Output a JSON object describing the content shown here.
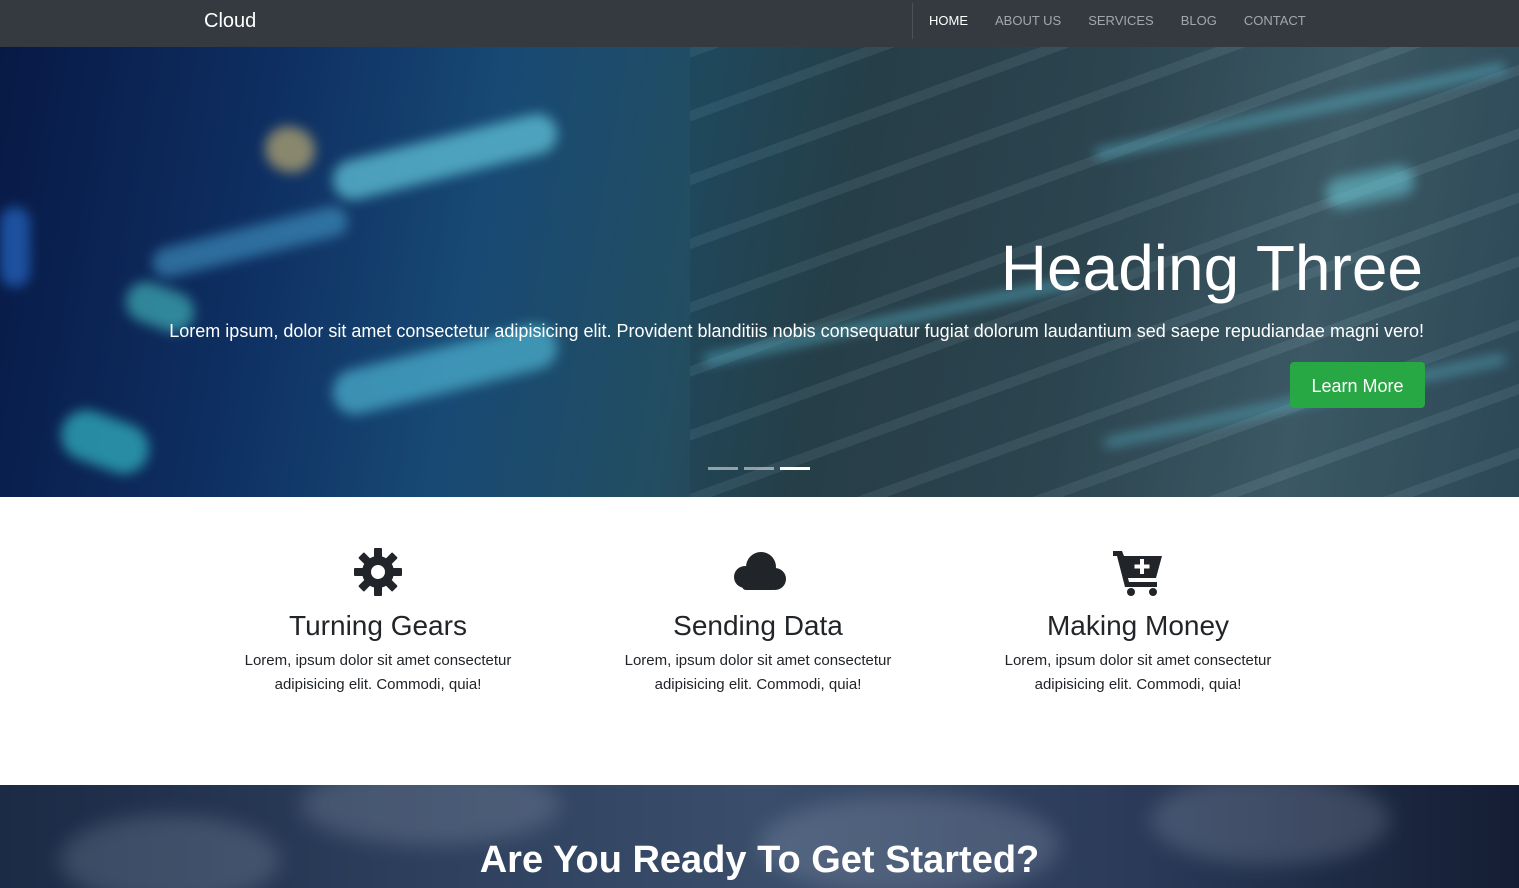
{
  "navbar": {
    "brand": "Cloud",
    "items": [
      {
        "label": "HOME",
        "active": true
      },
      {
        "label": "ABOUT US",
        "active": false
      },
      {
        "label": "SERVICES",
        "active": false
      },
      {
        "label": "BLOG",
        "active": false
      },
      {
        "label": "CONTACT",
        "active": false
      }
    ]
  },
  "hero": {
    "heading": "Heading Three",
    "text": "Lorem ipsum, dolor sit amet consectetur adipisicing elit. Provident blanditiis nobis consequatur fugiat dolorum laudantium sed saepe repudiandae magni vero!",
    "button_label": "Learn More",
    "slide_count": 3,
    "active_slide": 3
  },
  "features": [
    {
      "icon": "gear-icon",
      "title": "Turning Gears",
      "text_line1": "Lorem, ipsum dolor sit amet consectetur",
      "text_line2": "adipisicing elit. Commodi, quia!"
    },
    {
      "icon": "cloud-icon",
      "title": "Sending Data",
      "text_line1": "Lorem, ipsum dolor sit amet consectetur",
      "text_line2": "adipisicing elit. Commodi, quia!"
    },
    {
      "icon": "cart-plus-icon",
      "title": "Making Money",
      "text_line1": "Lorem, ipsum dolor sit amet consectetur",
      "text_line2": "adipisicing elit. Commodi, quia!"
    }
  ],
  "cta": {
    "heading": "Are You Ready To Get Started?"
  },
  "colors": {
    "navbar_bg": "#343a40",
    "button_green": "#28a745",
    "text_dark": "#212529"
  }
}
